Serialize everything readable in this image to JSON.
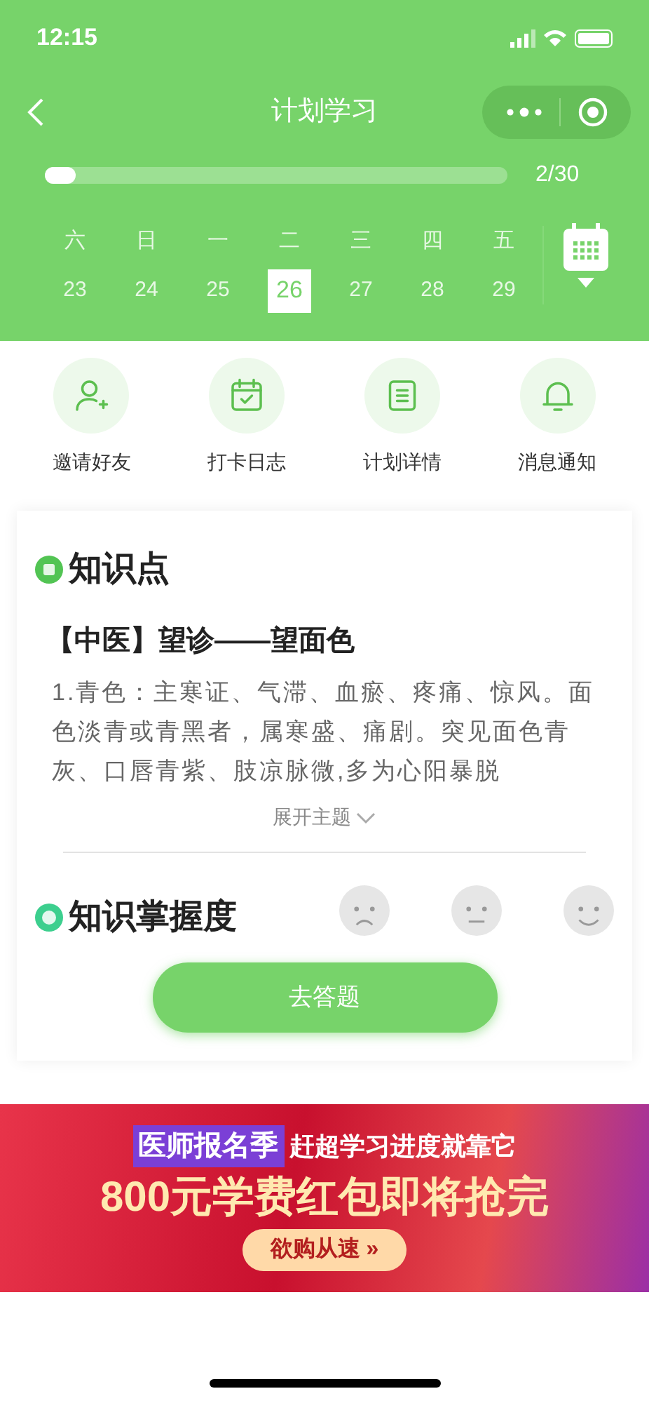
{
  "status_bar": {
    "time": "12:15"
  },
  "nav": {
    "title": "计划学习"
  },
  "progress": {
    "level": 0.067,
    "reading": "2/30"
  },
  "week": [
    {
      "weekday": "六",
      "date": "23",
      "selected": false
    },
    {
      "weekday": "日",
      "date": "24",
      "selected": false
    },
    {
      "weekday": "一",
      "date": "25",
      "selected": false
    },
    {
      "weekday": "二",
      "date": "26",
      "selected": true
    },
    {
      "weekday": "三",
      "date": "27",
      "selected": false
    },
    {
      "weekday": "四",
      "date": "28",
      "selected": false
    },
    {
      "weekday": "五",
      "date": "29",
      "selected": false
    }
  ],
  "actions": [
    {
      "kind": "invite",
      "label": "邀请好友"
    },
    {
      "kind": "checkin",
      "label": "打卡日志"
    },
    {
      "kind": "details",
      "label": "计划详情"
    },
    {
      "kind": "notify",
      "label": "消息通知"
    }
  ],
  "knowledge": {
    "heading": "知识点",
    "title": "【中医】望诊——望面色",
    "body": "1.青色：主寒证、气滞、血瘀、疼痛、惊风。面色淡青或青黑者，属寒盛、痛剧。突见面色青灰、口唇青紫、肢凉脉微,多为心阳暴脱",
    "expand": "展开主题"
  },
  "mastery": {
    "heading": "知识掌握度",
    "faces": [
      {
        "kind": "sad",
        "selected": false
      },
      {
        "kind": "neutral",
        "selected": false
      },
      {
        "kind": "happy",
        "selected": false
      }
    ],
    "button": "去答题"
  },
  "banner": {
    "line1_highlight": "医师报名季",
    "line1_rest": "赶超学习进度就靠它",
    "line2": "800元学费红包即将抢完",
    "button": "欲购从速 »"
  }
}
